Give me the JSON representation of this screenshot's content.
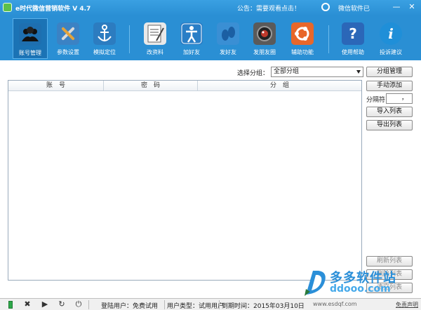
{
  "window": {
    "title": "e时代微信营销软件  V 4.7",
    "notice": "公告：需要观看点击！",
    "weixin_link": "微信软件已",
    "min_glyph": "—",
    "close_glyph": "✕"
  },
  "toolbar": {
    "items": [
      {
        "label": "账号管理",
        "color": "#1e6fb0"
      },
      {
        "label": "参数设置",
        "color": "#3b82c4"
      },
      {
        "label": "模拟定位",
        "color": "#2c7cc0"
      },
      {
        "label": "改资料",
        "color": "#e9e9e9"
      },
      {
        "label": "加好友",
        "color": "#2a7ec6"
      },
      {
        "label": "发好友",
        "color": "#3a8fd4"
      },
      {
        "label": "发朋友圈",
        "color": "#5a5a5a"
      },
      {
        "label": "辅助功能",
        "color": "#e8672a"
      },
      {
        "label": "使用帮助",
        "color": "#2b67b8"
      },
      {
        "label": "投诉建议",
        "color": "#1f8fd8"
      }
    ]
  },
  "group_select": {
    "label": "选择分组：",
    "value": "全部分组"
  },
  "table": {
    "columns": [
      "账　号",
      "密　码",
      "分　组"
    ],
    "rows": []
  },
  "side_buttons": {
    "group_manage": "分组管理",
    "manual_add": "手动添加",
    "separator_label": "分隔符",
    "separator_value": "，",
    "import_list": "导入列表",
    "export_list": "导出列表",
    "refresh_list": "刷新列表",
    "bottom_btn_1": "删除列表",
    "bottom_btn_2": "清空列表"
  },
  "watermark": {
    "brand": "多多软件站",
    "url": "ddooo.com"
  },
  "statusbar": {
    "login_user": "登陆用户：免费试用",
    "user_type": "用户类型：试用用户",
    "expire": "到期时间：2015年03月10日",
    "site": "www.esdqf.com",
    "disclaimer": "免责声明"
  }
}
